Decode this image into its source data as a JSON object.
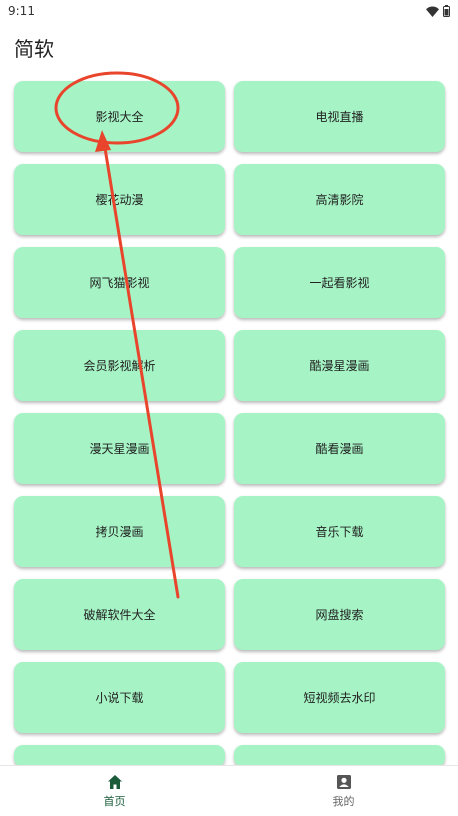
{
  "status_bar": {
    "time": "9:11"
  },
  "app": {
    "title": "简软"
  },
  "tiles": [
    "影视大全",
    "电视直播",
    "樱花动漫",
    "高清影院",
    "网飞猫影视",
    "一起看影视",
    "会员影视解析",
    "酷漫星漫画",
    "漫天星漫画",
    "酷看漫画",
    "拷贝漫画",
    "音乐下载",
    "破解软件大全",
    "网盘搜索",
    "小说下载",
    "短视频去水印"
  ],
  "colors": {
    "tile_bg": "#a6f4c5",
    "annotation": "#e8452c",
    "nav_active": "#1a5c3a",
    "nav_inactive": "#666666"
  },
  "bottom_nav": {
    "home": {
      "label": "首页",
      "icon": "home-icon"
    },
    "mine": {
      "label": "我的",
      "icon": "account-box-icon"
    }
  }
}
